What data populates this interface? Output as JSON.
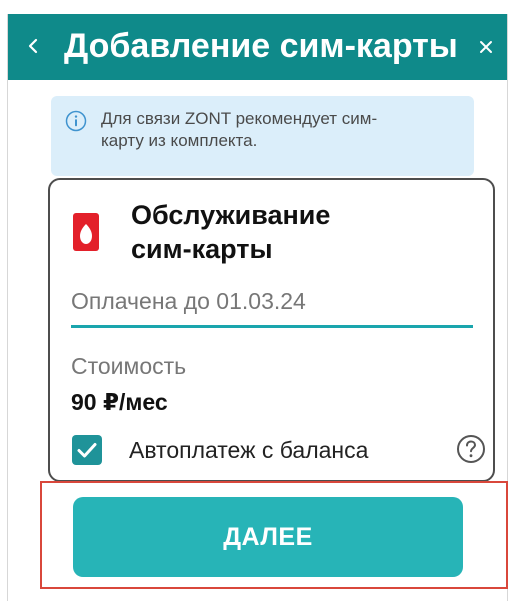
{
  "header": {
    "back_icon": "chevron-left-icon",
    "title": "Добавление сим-карты",
    "close_icon": "close-icon"
  },
  "info": {
    "icon": "info-icon",
    "text_line1": "Для связи ZONT рекомендует сим-",
    "text_line2": "карту из комплекта."
  },
  "card": {
    "logo_icon": "sim-provider-logo-icon",
    "title_line1": "Обслуживание",
    "title_line2": "сим-карты",
    "paid_until": "Оплачена до 01.03.24",
    "cost_label": "Стоимость",
    "cost_value": "90 ₽/мес",
    "autopay_label": "Автоплатеж с баланса",
    "autopay_checked": true,
    "help_icon": "question-circle-icon"
  },
  "actions": {
    "next_label": "ДАЛЕЕ"
  },
  "colors": {
    "header_bg": "#0f8a8a",
    "accent": "#27b4b7",
    "divider": "#1aa5ad",
    "info_bg": "#dbeefa",
    "highlight_border": "#d9473b",
    "logo_red": "#e3202a"
  }
}
